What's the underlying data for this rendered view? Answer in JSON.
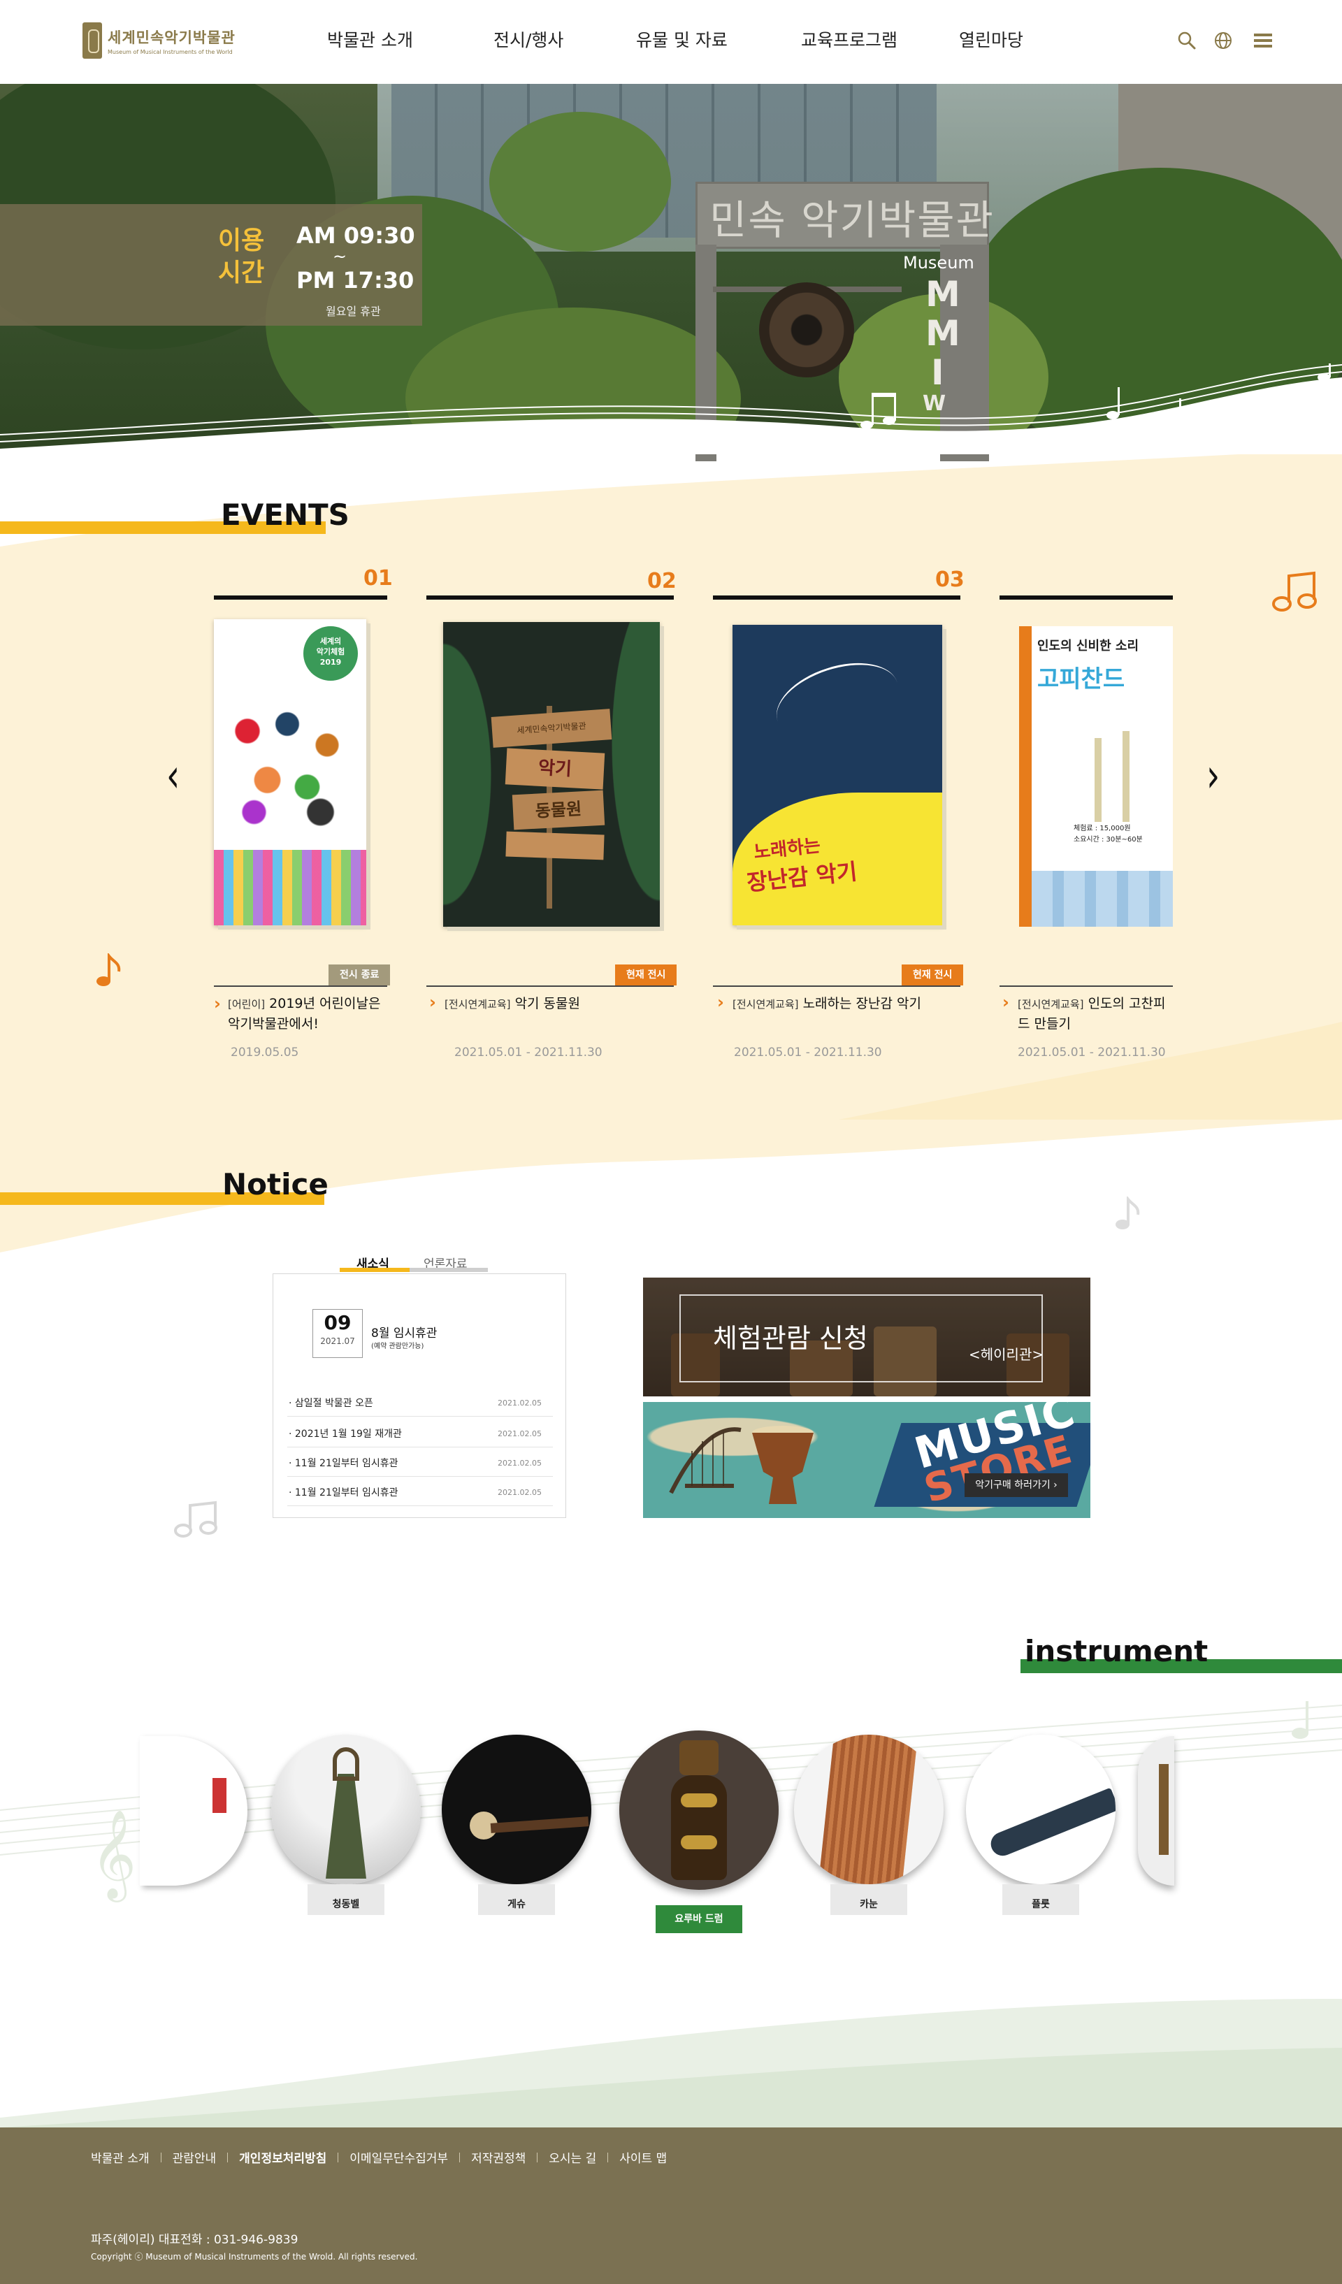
{
  "header": {
    "logo_ko": "세계민속악기박물관",
    "logo_en": "Museum of Musical Instruments of the World",
    "nav": [
      "박물관 소개",
      "전시/행사",
      "유물 및 자료",
      "교육프로그램",
      "열린마당"
    ],
    "icons": [
      "search-icon",
      "globe-icon",
      "menu-icon"
    ]
  },
  "hero": {
    "hours_label_1": "이용",
    "hours_label_2": "시간",
    "open": "AM 09:30",
    "tilde": "~",
    "close": "PM 17:30",
    "closed_day": "월요일 휴관",
    "gate_title": "민속 악기박물관",
    "gate_museum": "Museum",
    "gate_m1": "M",
    "gate_m2": "M",
    "gate_m3": "I",
    "gate_m4": "W"
  },
  "events": {
    "title": "EVENTS",
    "cards": [
      {
        "num": "01",
        "badge": "전시 종료",
        "badge_color": "#a39a7c",
        "category": "[어린이]",
        "title": "2019년 어린이날은 악기박물관에서!",
        "date": "2019.05.05",
        "poster_top_1": "세계의",
        "poster_top_2": "악기체험",
        "poster_top_3": "2019"
      },
      {
        "num": "02",
        "badge": "현재 전시",
        "badge_color": "#e77c1b",
        "category": "[전시연계교육]",
        "title": "악기 동물원",
        "date": "2021.05.01 - 2021.11.30",
        "poster_sign_1": "세계민속악기박물관",
        "poster_sign_2": "악기",
        "poster_sign_3": "동물원"
      },
      {
        "num": "03",
        "badge": "현재 전시",
        "badge_color": "#e77c1b",
        "category": "[전시연계교육]",
        "title": "노래하는 장난감 악기",
        "date": "2021.05.01 - 2021.11.30",
        "poster_t1": "노래하는",
        "poster_t2": "장난감 악기"
      },
      {
        "num": "",
        "badge": "",
        "badge_color": "",
        "category": "[전시연계교육]",
        "title": "인도의 고찬피드 만들기",
        "date": "2021.05.01 - 2021.11.30",
        "poster_t1": "인도의 신비한 소리",
        "poster_t2": "고피찬드",
        "poster_price": "체험료 : 15,000원",
        "poster_time": "소요시간 : 30분~60분"
      }
    ]
  },
  "notice": {
    "title": "Notice",
    "tabs": [
      "새소식",
      "언론자료"
    ],
    "featured": {
      "day": "09",
      "ym": "2021.07",
      "title": "8월 임시휴관",
      "sub": "(예약 관람만가능)"
    },
    "items": [
      {
        "title": "· 삼일절 박물관 오픈",
        "date": "2021.02.05"
      },
      {
        "title": "· 2021년 1월 19일 재개관",
        "date": "2021.02.05"
      },
      {
        "title": "· 11월 21일부터 임시휴관",
        "date": "2021.02.05"
      },
      {
        "title": "· 11월 21일부터 임시휴관",
        "date": "2021.02.05"
      }
    ],
    "banner1": {
      "title": "체험관람 신청",
      "sub": "<헤이리관>"
    },
    "banner2": {
      "music": "MUSIC",
      "store": "STORE",
      "button": "악기구매 하러가기 ›"
    }
  },
  "instrument": {
    "title": "instrument",
    "items": [
      {
        "label": "청동벨",
        "active": false
      },
      {
        "label": "게슈",
        "active": false
      },
      {
        "label": "요루바 드럼",
        "active": true
      },
      {
        "label": "카눈",
        "active": false
      },
      {
        "label": "플룻",
        "active": false
      }
    ]
  },
  "footer": {
    "links": [
      "박물관 소개",
      "관람안내",
      "개인정보처리방침",
      "이메일무단수집거부",
      "저작권정책",
      "오시는 길",
      "사이트 맵"
    ],
    "bold_index": 2,
    "contact": "파주(헤이리)  대표전화 : 031-946-9839",
    "copyright": "Copyright ⓒ Museum of Musical Instruments of the Wrold. All rights reserved."
  },
  "colors": {
    "accent_yellow": "#f5b81c",
    "accent_orange": "#e77c1b",
    "cream": "#fdf2d7",
    "green": "#2f8a3b",
    "footer": "#7b7152"
  }
}
